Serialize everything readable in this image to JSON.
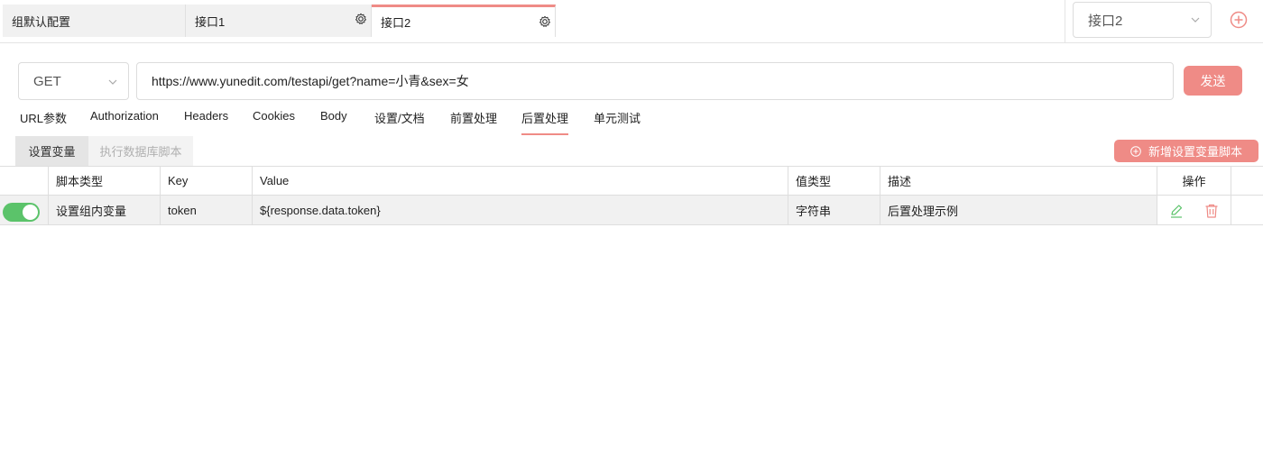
{
  "tabs": [
    {
      "label": "组默认配置"
    },
    {
      "label": "接口1"
    },
    {
      "label": "接口2"
    }
  ],
  "env_select": {
    "value": "接口2"
  },
  "request": {
    "method": "GET",
    "url": "https://www.yunedit.com/testapi/get?name=小青&sex=女",
    "send_label": "发送"
  },
  "subtabs": [
    "URL参数",
    "Authorization",
    "Headers",
    "Cookies",
    "Body",
    "设置/文档",
    "前置处理",
    "后置处理",
    "单元测试"
  ],
  "active_subtab": "后置处理",
  "segments": {
    "on": "设置变量",
    "off": "执行数据库脚本"
  },
  "new_button_label": "新增设置变量脚本",
  "table": {
    "headers": {
      "type": "脚本类型",
      "key": "Key",
      "value": "Value",
      "vtype": "值类型",
      "desc": "描述",
      "ops": "操作"
    },
    "rows": [
      {
        "enabled": true,
        "type": "设置组内变量",
        "key": "token",
        "value": "${response.data.token}",
        "vtype": "字符串",
        "desc": "后置处理示例"
      }
    ]
  },
  "colors": {
    "accent": "#ef8b86",
    "toggle_on": "#5bc36a",
    "edit_icon": "#5bc36a",
    "delete_icon": "#ef8b86"
  }
}
